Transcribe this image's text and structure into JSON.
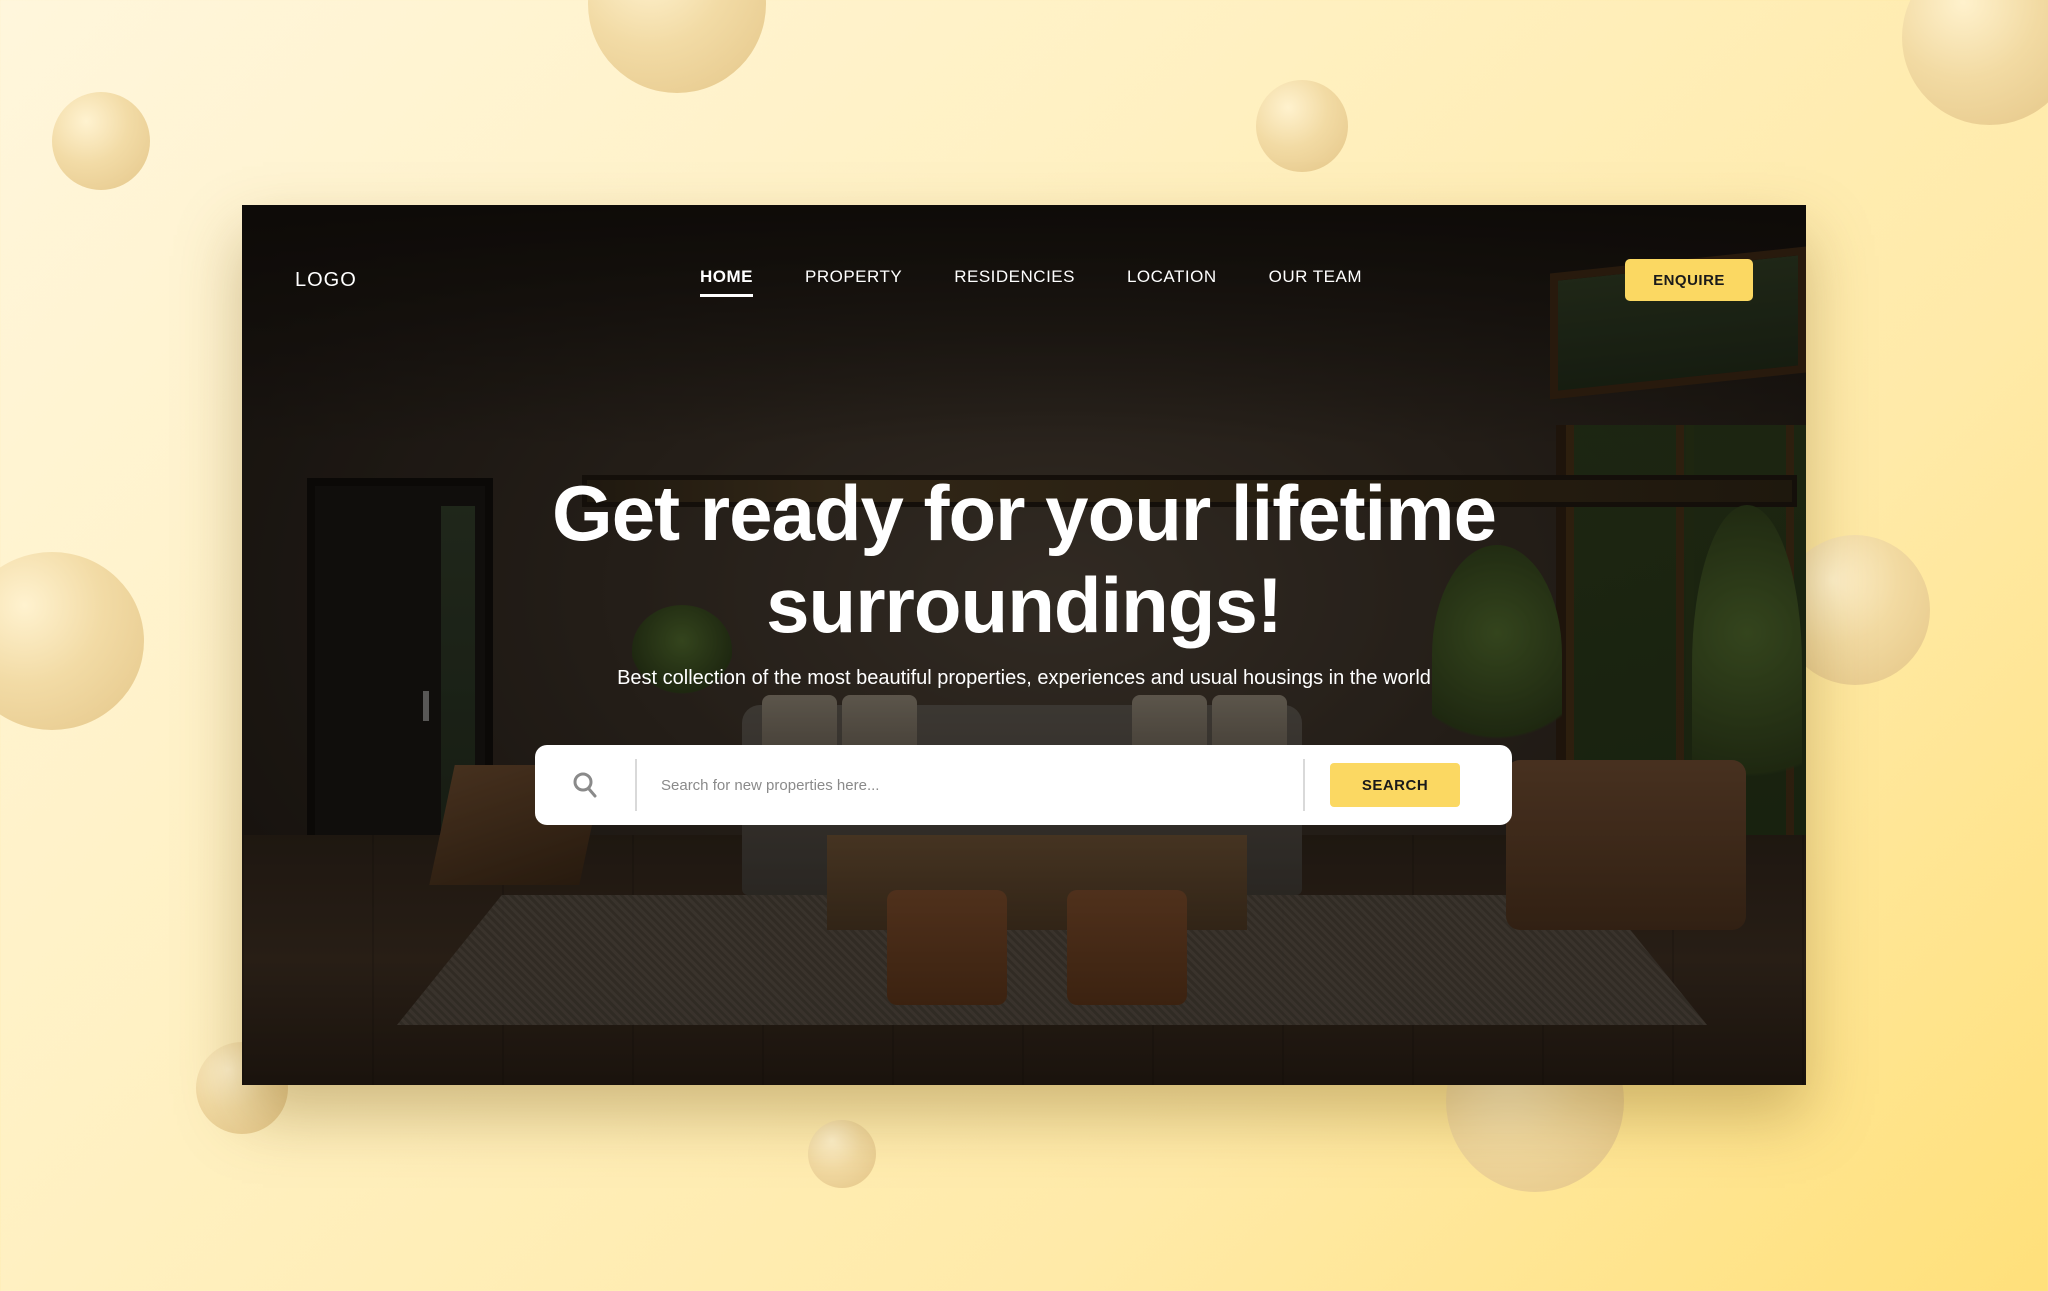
{
  "nav": {
    "logo": "LOGO",
    "items": [
      {
        "label": "HOME",
        "active": true
      },
      {
        "label": "PROPERTY",
        "active": false
      },
      {
        "label": "RESIDENCIES",
        "active": false
      },
      {
        "label": "LOCATION",
        "active": false
      },
      {
        "label": "OUR TEAM",
        "active": false
      }
    ],
    "cta_label": "ENQUIRE"
  },
  "hero": {
    "title_line1": "Get ready for your lifetime",
    "title_line2": "surroundings!",
    "subtitle": "Best collection of the most beautiful properties, experiences and usual housings in the world"
  },
  "search": {
    "placeholder": "Search for new properties here...",
    "value": "",
    "button_label": "SEARCH",
    "icon": "search-icon"
  },
  "colors": {
    "accent": "#fbd862",
    "background": "#ffeaa8"
  }
}
